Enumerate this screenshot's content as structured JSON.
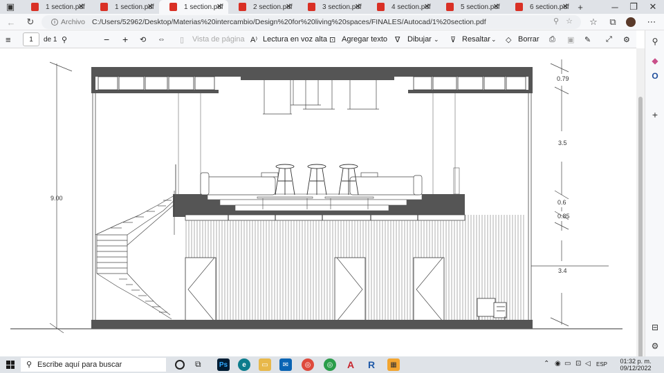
{
  "tabs": [
    {
      "label": "1 section.pdf",
      "active": false
    },
    {
      "label": "1 section.pdf",
      "active": false
    },
    {
      "label": "1 section.pdf",
      "active": true
    },
    {
      "label": "2 section.pdf",
      "active": false
    },
    {
      "label": "3 section.pdf",
      "active": false
    },
    {
      "label": "4 section.pdf",
      "active": false
    },
    {
      "label": "5 section.pdf",
      "active": false
    },
    {
      "label": "6 section.pdf",
      "active": false
    }
  ],
  "address": {
    "archivo_label": "Archivo",
    "url": "C:/Users/52962/Desktop/Materias%20intercambio/Design%20for%20living%20spaces/FINALES/Autocad/1%20section.pdf"
  },
  "pdf_toolbar": {
    "page_number": "1",
    "page_total": "de 1",
    "page_view": "Vista de página",
    "read_aloud": "Lectura en voz alta",
    "add_text": "Agregar texto",
    "draw": "Dibujar",
    "highlight": "Resaltar",
    "erase": "Borrar"
  },
  "drawing": {
    "height_total": "9.00",
    "dimensions": [
      "0.79",
      "3.5",
      "0.6",
      "0.85",
      "3.4"
    ]
  },
  "taskbar": {
    "search_placeholder": "Escribe aquí para buscar",
    "language": "ESP",
    "time": "01:32 p. m.",
    "date": "09/12/2022"
  }
}
